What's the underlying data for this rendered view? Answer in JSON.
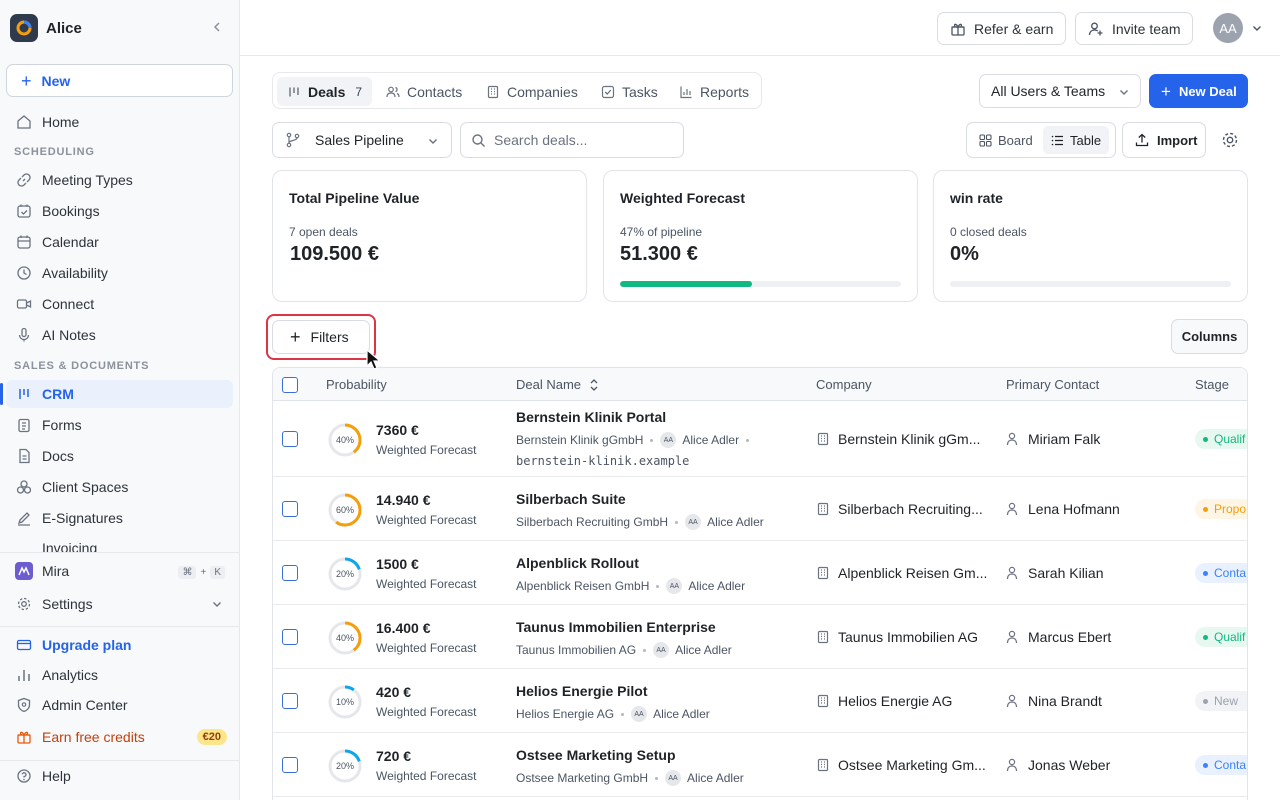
{
  "workspace": {
    "name": "Alice"
  },
  "sidebar": {
    "new_label": "New",
    "home": "Home",
    "sections": {
      "scheduling": "SCHEDULING",
      "sales": "SALES & DOCUMENTS"
    },
    "scheduling_items": [
      "Meeting Types",
      "Bookings",
      "Calendar",
      "Availability",
      "Connect",
      "AI Notes"
    ],
    "sales_items": [
      "CRM",
      "Forms",
      "Docs",
      "Client Spaces",
      "E-Signatures",
      "Invoicing"
    ],
    "mira": {
      "label": "Mira",
      "shortcut_cmd": "⌘",
      "shortcut_plus": "+",
      "shortcut_key": "K"
    },
    "settings": "Settings",
    "upgrade": "Upgrade plan",
    "analytics": "Analytics",
    "admin": "Admin Center",
    "credits": {
      "label": "Earn free credits",
      "badge": "€20"
    },
    "help": "Help"
  },
  "topbar": {
    "refer": "Refer & earn",
    "invite": "Invite team",
    "avatar": "AA"
  },
  "tabs": [
    {
      "label": "Deals",
      "count": "7"
    },
    {
      "label": "Contacts"
    },
    {
      "label": "Companies"
    },
    {
      "label": "Tasks"
    },
    {
      "label": "Reports"
    }
  ],
  "users_filter": "All Users & Teams",
  "new_deal": "New Deal",
  "pipeline": "Sales Pipeline",
  "search": {
    "placeholder": "Search deals...",
    "value": ""
  },
  "view": {
    "board": "Board",
    "table": "Table"
  },
  "import": "Import",
  "stats": [
    {
      "title": "Total Pipeline Value",
      "sub": "7 open deals",
      "value": "109.500 €"
    },
    {
      "title": "Weighted Forecast",
      "sub": "47% of pipeline",
      "value": "51.300 €",
      "progress": 0.47,
      "color": "#10b981"
    },
    {
      "title": "win rate",
      "sub": "0 closed deals",
      "value": "0%",
      "progress": 0
    }
  ],
  "filters": "Filters",
  "columns": "Columns",
  "table": {
    "headers": {
      "probability": "Probability",
      "deal": "Deal Name",
      "company": "Company",
      "contact": "Primary Contact",
      "stage": "Stage"
    },
    "weighted_label": "Weighted Forecast",
    "rows": [
      {
        "prob": 0.4,
        "prob_label": "40%",
        "color": "#f59e0b",
        "amount": "7360 €",
        "name": "Bernstein Klinik Portal",
        "company_full": "Bernstein Klinik gGmbH",
        "owner": "Alice Adler",
        "owner_initials": "AA",
        "domain": "bernstein-klinik.example",
        "company": "Bernstein Klinik gGm...",
        "contact": "Miriam Falk",
        "stage": "Qualif",
        "stage_color": "#10b981",
        "stage_bg": "#e7f8f0"
      },
      {
        "prob": 0.6,
        "prob_label": "60%",
        "color": "#f59e0b",
        "amount": "14.940 €",
        "name": "Silberbach Suite",
        "company_full": "Silberbach Recruiting GmbH",
        "owner": "Alice Adler",
        "owner_initials": "AA",
        "company": "Silberbach Recruiting...",
        "contact": "Lena Hofmann",
        "stage": "Propo",
        "stage_color": "#f59e0b",
        "stage_bg": "#fef5e4"
      },
      {
        "prob": 0.2,
        "prob_label": "20%",
        "color": "#0ea5e9",
        "amount": "1500 €",
        "name": "Alpenblick Rollout",
        "company_full": "Alpenblick Reisen GmbH",
        "owner": "Alice Adler",
        "owner_initials": "AA",
        "company": "Alpenblick Reisen Gm...",
        "contact": "Sarah Kilian",
        "stage": "Conta",
        "stage_color": "#3b82f6",
        "stage_bg": "#e8f1fd"
      },
      {
        "prob": 0.4,
        "prob_label": "40%",
        "color": "#f59e0b",
        "amount": "16.400 €",
        "name": "Taunus Immobilien Enterprise",
        "company_full": "Taunus Immobilien AG",
        "owner": "Alice Adler",
        "owner_initials": "AA",
        "company": "Taunus Immobilien AG",
        "contact": "Marcus Ebert",
        "stage": "Qualif",
        "stage_color": "#10b981",
        "stage_bg": "#e7f8f0"
      },
      {
        "prob": 0.1,
        "prob_label": "10%",
        "color": "#0ea5e9",
        "amount": "420 €",
        "name": "Helios Energie Pilot",
        "company_full": "Helios Energie AG",
        "owner": "Alice Adler",
        "owner_initials": "AA",
        "company": "Helios Energie AG",
        "contact": "Nina Brandt",
        "stage": "New",
        "stage_color": "#9ca3af",
        "stage_bg": "#f1f3f6"
      },
      {
        "prob": 0.2,
        "prob_label": "20%",
        "color": "#0ea5e9",
        "amount": "720 €",
        "name": "Ostsee Marketing Setup",
        "company_full": "Ostsee Marketing GmbH",
        "owner": "Alice Adler",
        "owner_initials": "AA",
        "company": "Ostsee Marketing Gm...",
        "contact": "Jonas Weber",
        "stage": "Conta",
        "stage_color": "#3b82f6",
        "stage_bg": "#e8f1fd"
      }
    ]
  }
}
